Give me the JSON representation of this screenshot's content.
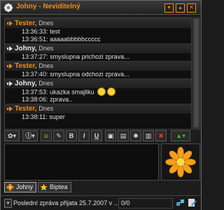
{
  "window": {
    "title": "Johny - Neviditelný"
  },
  "messages": [
    {
      "author": "Tester",
      "date": "Dnes",
      "incoming": true,
      "lines": [
        {
          "time": "13:36:33:",
          "text": "test"
        },
        {
          "time": "13:36:51:",
          "text": "aaaaabbbbbccccc"
        }
      ]
    },
    {
      "author": "Johny",
      "date": "Dnes",
      "incoming": false,
      "lines": [
        {
          "time": "13:37:27:",
          "text": "smyslupna prichozi zprava..."
        }
      ]
    },
    {
      "author": "Tester",
      "date": "Dnes",
      "incoming": true,
      "lines": [
        {
          "time": "13:37:40:",
          "text": "smyslupna odchozi zprava..."
        }
      ]
    },
    {
      "author": "Johny",
      "date": "Dnes",
      "incoming": false,
      "lines": [
        {
          "time": "13:37:53:",
          "text": "ukazka smajliku"
        },
        {
          "time": "13:38:06:",
          "text": "zprava.."
        }
      ]
    },
    {
      "author": "Tester",
      "date": "Dnes",
      "incoming": true,
      "lines": [
        {
          "time": "13:38:11:",
          "text": "super"
        }
      ]
    }
  ],
  "toolbar": {
    "bold": "B",
    "italic": "I",
    "underline": "U"
  },
  "tabs": [
    {
      "label": "Johny"
    },
    {
      "label": "Biptea"
    }
  ],
  "status": {
    "last_message": "Poslední zpráva přijata 25.7.2007 v ...",
    "counter": "0/0"
  },
  "colors": {
    "accent": "#f08c1a",
    "background": "#1d1d1d"
  }
}
